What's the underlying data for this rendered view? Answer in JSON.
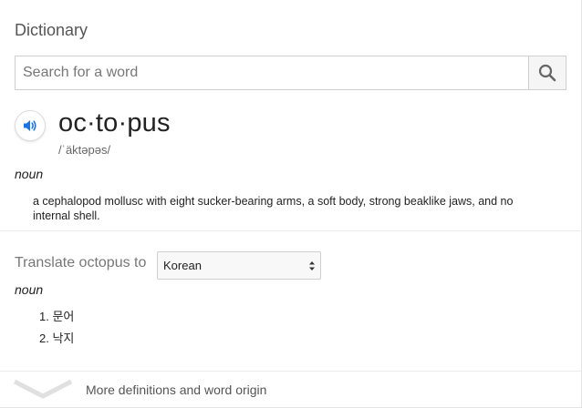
{
  "title": "Dictionary",
  "search": {
    "placeholder": "Search for a word",
    "icon": "search-icon"
  },
  "entry": {
    "speaker_icon": "speaker-icon",
    "headword": "oc·to·pus",
    "phonetic": "/ˈäktəpəs/",
    "part_of_speech": "noun",
    "definition": "a cephalopod mollusc with eight sucker-bearing arms, a soft body, strong beaklike jaws, and no internal shell."
  },
  "translate": {
    "label": "Translate octopus to",
    "language": "Korean",
    "part_of_speech": "noun",
    "items": [
      {
        "num": "1.",
        "text": "문어"
      },
      {
        "num": "2.",
        "text": "낙지"
      }
    ]
  },
  "more": {
    "label": "More definitions and word origin",
    "icon": "chevron-down-icon"
  },
  "colors": {
    "speaker_blue": "#1a73e8",
    "search_icon": "#666666",
    "chevron": "#e0e0e0"
  }
}
